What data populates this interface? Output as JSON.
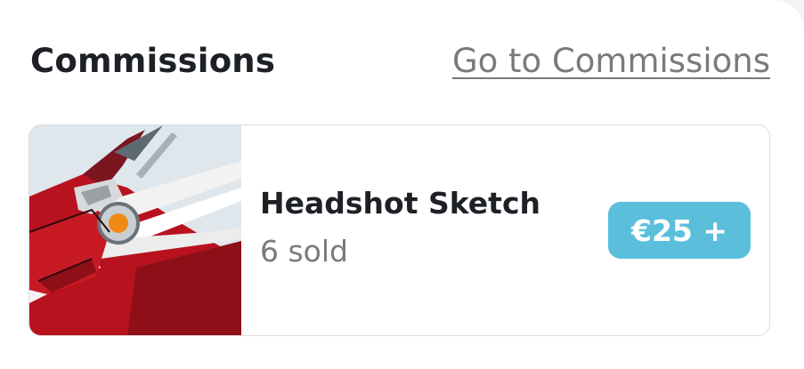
{
  "section": {
    "title": "Commissions",
    "link_label": "Go to Commissions"
  },
  "commission": {
    "title": "Headshot Sketch",
    "sold": "6 sold",
    "price": "€25 +",
    "thumbnail_icon": "dragon-headshot-artwork"
  },
  "colors": {
    "price_badge": "#5bbfdc",
    "title_text": "#1d2126",
    "muted_text": "#7a7a7a"
  }
}
